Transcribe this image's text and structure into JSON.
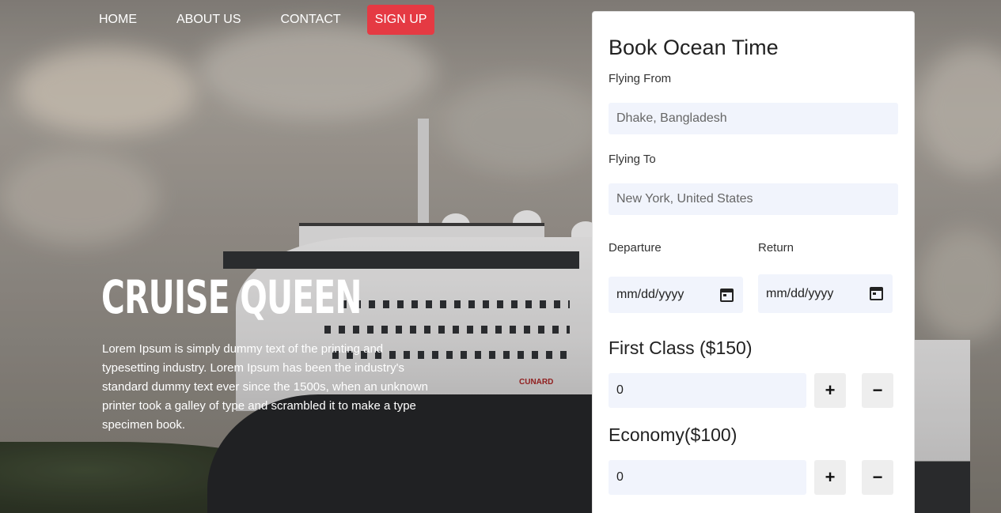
{
  "nav": {
    "items": [
      "HOME",
      "ABOUT US",
      "CONTACT"
    ],
    "signup_label": "SIGN UP",
    "signup_color": "#e53a43"
  },
  "hero": {
    "title": "CRUISE QUEEN",
    "text": "Lorem Ipsum is simply dummy text of the printing and typesetting industry. Lorem Ipsum has been the industry's standard dummy text ever since the 1500s, when an unknown printer took a galley of type and scrambled it to make a type specimen book.",
    "ship_text": "CUNARD"
  },
  "booking": {
    "title": "Book Ocean Time",
    "from_label": "Flying From",
    "from_placeholder": "Dhake, Bangladesh",
    "to_label": "Flying To",
    "to_placeholder": "New York, United States",
    "departure_label": "Departure",
    "return_label": "Return",
    "departure_value": "mm/dd/yyyy",
    "return_value": "mm/dd/yyyy",
    "first_class_label": "First Class ($150)",
    "first_class_qty": "0",
    "economy_label": "Economy($100)",
    "economy_qty": "0",
    "plus": "+",
    "minus": "−",
    "calendar_icon": "calendar-icon"
  }
}
